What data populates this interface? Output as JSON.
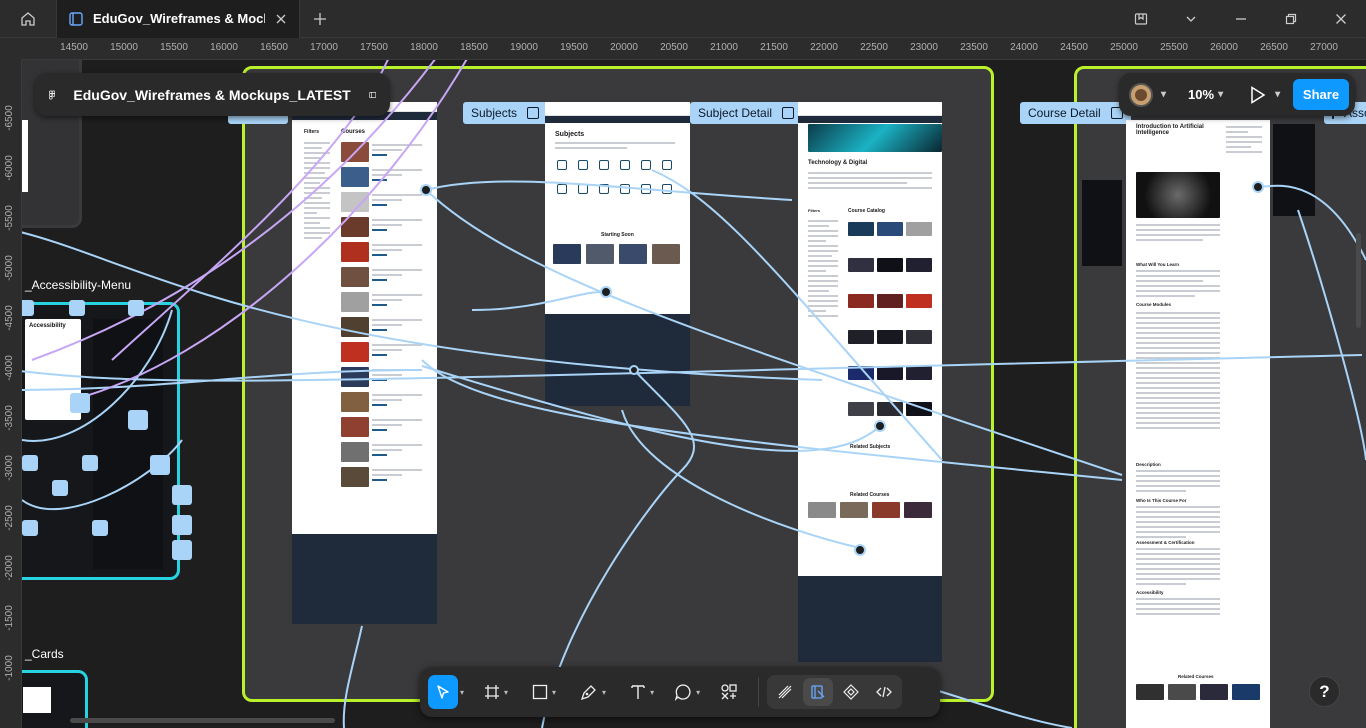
{
  "window": {
    "tab_title": "EduGov_Wireframes & Mockups_LATEST",
    "tab_title_truncated": "EduGov_Wireframes & Mockups_l"
  },
  "file": {
    "name": "EduGov_Wireframes & Mockups_LATEST"
  },
  "header": {
    "zoom": "10%",
    "share_label": "Share"
  },
  "ruler": {
    "top": [
      "14500",
      "15000",
      "15500",
      "16000",
      "16500",
      "17000",
      "17500",
      "18000",
      "18500",
      "19000",
      "19500",
      "20000",
      "20500",
      "21000",
      "21500",
      "22000",
      "22500",
      "23000",
      "23500",
      "24000",
      "24500",
      "25000",
      "25500",
      "26000",
      "26500",
      "27000"
    ],
    "left": [
      "-6500",
      "-6000",
      "-5500",
      "-5000",
      "-4500",
      "-4000",
      "-3500",
      "-3000",
      "-2500",
      "-2000",
      "-1500",
      "-1000"
    ]
  },
  "canvas": {
    "sections": {
      "accessibility_menu": "_Accessibility-Menu",
      "cards": "_Cards",
      "next_partial": "Asso"
    },
    "frames": {
      "subjects": "Subjects",
      "subject_detail": "Subject Detail",
      "course_detail": "Course Detail"
    },
    "pages": {
      "courses_heading": "Courses",
      "subjects_heading": "Subjects",
      "starting_soon": "Starting Soon",
      "tech_digital_heading": "Technology & Digital",
      "course_catalog": "Course Catalog",
      "related_subjects": "Related Subjects",
      "related_courses": "Related Courses",
      "course_title": "Introduction to Artificial Intelligence",
      "what_you_learn": "What Will You Learn",
      "course_modules": "Course Modules",
      "description": "Description",
      "who_for": "Who Is This Course For",
      "assessment": "Assessment & Certification",
      "accessibility": "Accessibility",
      "related_courses_2": "Related Courses",
      "accessibility_panel": "Accessibility",
      "filters": "Filters"
    }
  },
  "icons": {
    "home": "home-icon",
    "design_file": "design-file-icon",
    "close": "close-icon",
    "plus": "plus-icon",
    "book": "book-icon",
    "chevron": "chevron-down-icon",
    "minimize": "minimize-icon",
    "restore": "restore-icon",
    "logo": "figma-logo-icon",
    "sidebar": "sidebar-toggle-icon",
    "play": "play-icon",
    "move": "move-tool-icon",
    "frame": "frame-tool-icon",
    "rect": "rectangle-tool-icon",
    "pen": "pen-tool-icon",
    "text": "text-tool-icon",
    "comment": "comment-tool-icon",
    "actions": "actions-icon",
    "draw": "draw-mode-icon",
    "design": "design-mode-icon",
    "dev": "dev-mode-icon",
    "code": "code-icon",
    "help": "help-icon"
  },
  "colors": {
    "accent": "#0d99ff",
    "section_border": "#b9f12a",
    "component_border": "#27d3e0",
    "frame_label": "#a9d4f7",
    "connector": "#a9d4f7",
    "purple_connector": "#c7a6f5"
  }
}
